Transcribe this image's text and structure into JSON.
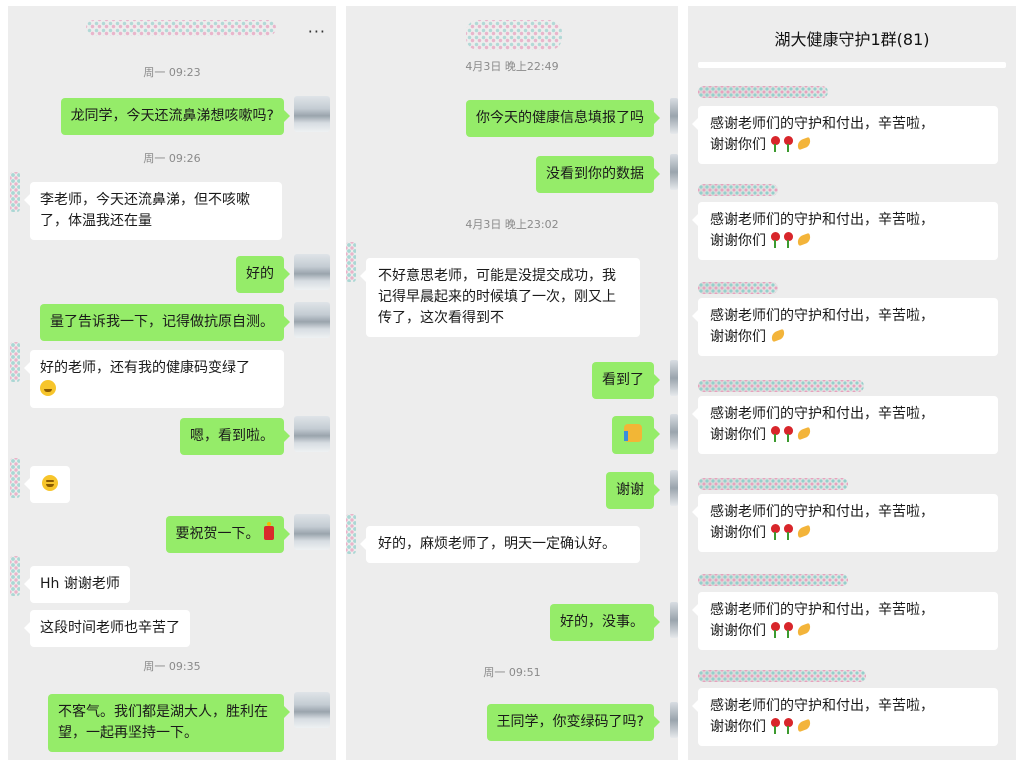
{
  "panel1": {
    "more_icon": "···",
    "timestamps": [
      "周一 09:23",
      "周一 09:26",
      "周一 09:35"
    ],
    "messages": [
      {
        "side": "out",
        "text": "龙同学，今天还流鼻涕想咳嗽吗?"
      },
      {
        "side": "in",
        "text": "李老师，今天还流鼻涕，但不咳嗽了，体温我还在量"
      },
      {
        "side": "out",
        "text": "好的"
      },
      {
        "side": "out",
        "text": "量了告诉我一下，记得做抗原自测。"
      },
      {
        "side": "in",
        "text": "好的老师，还有我的健康码变绿了"
      },
      {
        "side": "out",
        "text": "嗯，看到啦。"
      },
      {
        "side": "out",
        "text": "要祝贺一下。"
      },
      {
        "side": "in",
        "text": "Hh 谢谢老师"
      },
      {
        "side": "in",
        "text": "这段时间老师也辛苦了"
      },
      {
        "side": "out",
        "text": "不客气。我们都是湖大人，胜利在望，一起再坚持一下。"
      }
    ]
  },
  "panel2": {
    "timestamps": [
      "4月3日 晚上22:49",
      "4月3日 晚上23:02",
      "周一 09:51"
    ],
    "messages": [
      {
        "side": "out",
        "text": "你今天的健康信息填报了吗"
      },
      {
        "side": "out",
        "text": "没看到你的数据"
      },
      {
        "side": "in",
        "text": "不好意思老师，可能是没提交成功，我记得早晨起来的时候填了一次，刚又上传了，这次看得到不"
      },
      {
        "side": "out",
        "text": "看到了"
      },
      {
        "side": "out",
        "text": "谢谢"
      },
      {
        "side": "in",
        "text": "好的，麻烦老师了，明天一定确认好。"
      },
      {
        "side": "out",
        "text": "好的，没事。"
      },
      {
        "side": "out",
        "text": "王同学，你变绿码了吗?"
      }
    ]
  },
  "panel3": {
    "group_title": "湖大健康守护1群(81)",
    "messages": [
      {
        "line1": "感谢老师们的守护和付出，辛苦啦，",
        "line2": "谢谢你们"
      },
      {
        "line1": "感谢老师们的守护和付出，辛苦啦，",
        "line2": "谢谢你们"
      },
      {
        "line1": "感谢老师们的守护和付出，辛苦啦，",
        "line2": "谢谢你们"
      },
      {
        "line1": "感谢老师们的守护和付出，辛苦啦，",
        "line2": "谢谢你们"
      },
      {
        "line1": "感谢老师们的守护和付出，辛苦啦，",
        "line2": "谢谢你们"
      },
      {
        "line1": "感谢老师们的守护和付出，辛苦啦，",
        "line2": "谢谢你们"
      },
      {
        "line1": "感谢老师们的守护和付出，辛苦啦，",
        "line2": "谢谢你们"
      }
    ]
  },
  "colors": {
    "chat_background": "#ededed",
    "outgoing_bubble": "#95ec69",
    "incoming_bubble": "#ffffff",
    "timestamp_text": "#8a8a8a"
  }
}
